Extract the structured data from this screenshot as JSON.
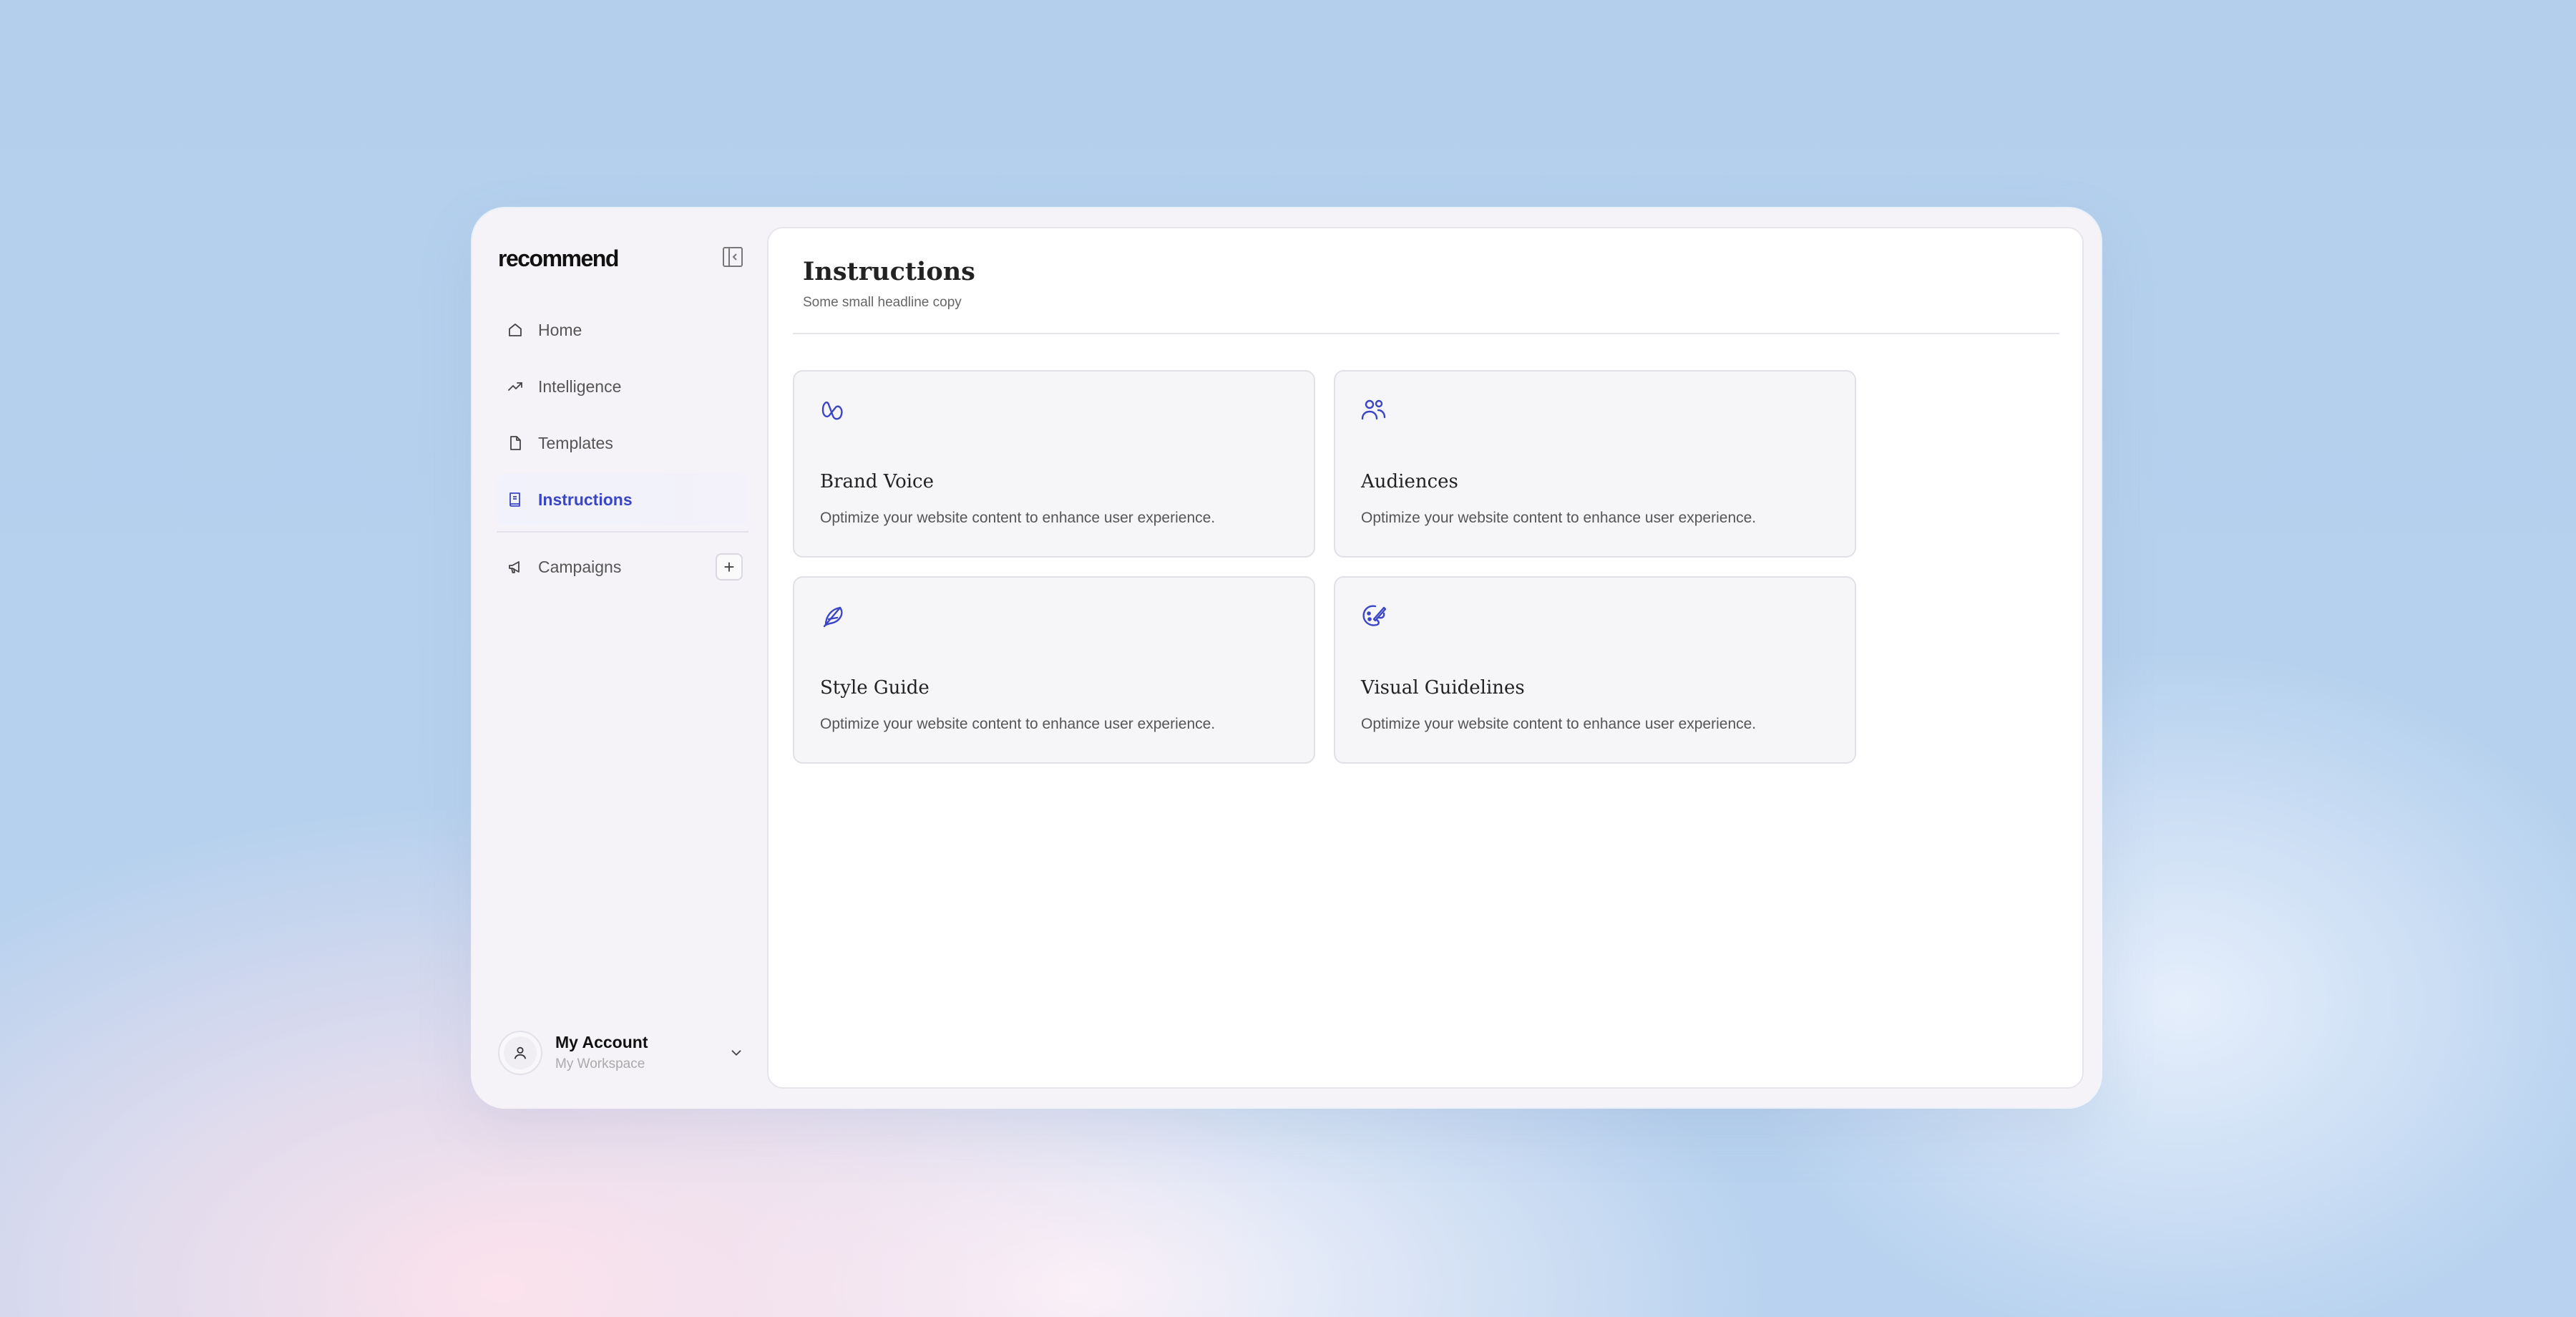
{
  "app": {
    "logo": "recommend"
  },
  "sidebar": {
    "items": [
      {
        "label": "Home",
        "icon": "home-icon"
      },
      {
        "label": "Intelligence",
        "icon": "trending-up-icon"
      },
      {
        "label": "Templates",
        "icon": "file-icon"
      },
      {
        "label": "Instructions",
        "icon": "book-icon",
        "active": true
      },
      {
        "label": "Campaigns",
        "icon": "megaphone-icon"
      }
    ],
    "campaigns_add": "+"
  },
  "account": {
    "name": "My Account",
    "workspace": "My Workspace"
  },
  "main": {
    "title": "Instructions",
    "subtitle": "Some small headline copy",
    "cards": [
      {
        "title": "Brand Voice",
        "description": "Optimize your website content to enhance user experience.",
        "icon": "brand-voice-icon"
      },
      {
        "title": "Audiences",
        "description": "Optimize your website content to enhance user experience.",
        "icon": "users-icon"
      },
      {
        "title": "Style Guide",
        "description": "Optimize your website content to enhance user experience.",
        "icon": "feather-icon"
      },
      {
        "title": "Visual Guidelines",
        "description": "Optimize your website content to enhance user experience.",
        "icon": "palette-icon"
      }
    ]
  },
  "colors": {
    "accent": "#3a46c5",
    "card_bg": "#f6f5f8",
    "sidebar_bg": "#f5f3f7"
  }
}
